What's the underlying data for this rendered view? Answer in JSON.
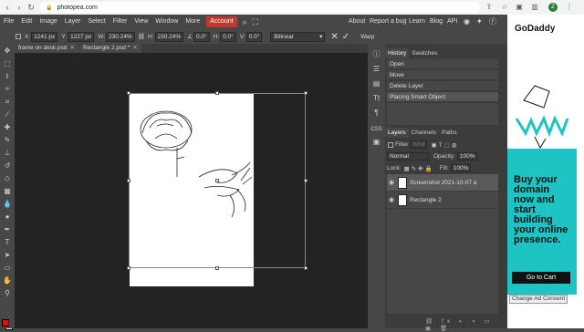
{
  "browser": {
    "url": "photopea.com",
    "profile_initial": "Z"
  },
  "menu": {
    "items": [
      "File",
      "Edit",
      "Image",
      "Layer",
      "Select",
      "Filter",
      "View",
      "Window",
      "More"
    ],
    "account": "Account",
    "right": [
      "About",
      "Report a bug",
      "Learn",
      "Blog",
      "API"
    ]
  },
  "options": {
    "x_label": "X:",
    "x_value": "1241 px",
    "y_label": "Y:",
    "y_value": "1227 px",
    "w_label": "W:",
    "w_value": "230.24%",
    "h_label": "H:",
    "h_value": "230.24%",
    "angle_value": "0.0°",
    "skew_h_label": "H:",
    "skew_h_value": "0.0°",
    "skew_v_label": "V:",
    "skew_v_value": "0.0°",
    "interpolation": "Bilinear",
    "warp": "Warp"
  },
  "tabs": [
    {
      "label": "frame on desk.psd"
    },
    {
      "label": "Rectangle 2.psd *"
    }
  ],
  "history": {
    "tab_history": "History",
    "tab_swatches": "Swatches",
    "items": [
      "Open",
      "Move",
      "Delete Layer",
      "Placing Smart Object"
    ]
  },
  "layers": {
    "tab_layers": "Layers",
    "tab_channels": "Channels",
    "tab_paths": "Paths",
    "filter_label": "Filter",
    "kind": "Kind",
    "blend_mode": "Normal",
    "opacity_label": "Opacity:",
    "opacity_value": "100%",
    "lock_label": "Lock:",
    "fill_label": "Fill:",
    "fill_value": "100%",
    "rows": [
      {
        "name": "Screenshot 2021-10-07 a"
      },
      {
        "name": "Rectangle 2"
      }
    ]
  },
  "ad": {
    "brand": "GoDaddy",
    "headline": "Buy your domain now and start building your online presence.",
    "cta": "Go to Cart",
    "consent": "Change Ad Consent"
  },
  "colors": {
    "foreground": "#ff0000",
    "background": "#ffffff",
    "accent": "#c0392b",
    "ad_teal": "#1ec4c4"
  }
}
